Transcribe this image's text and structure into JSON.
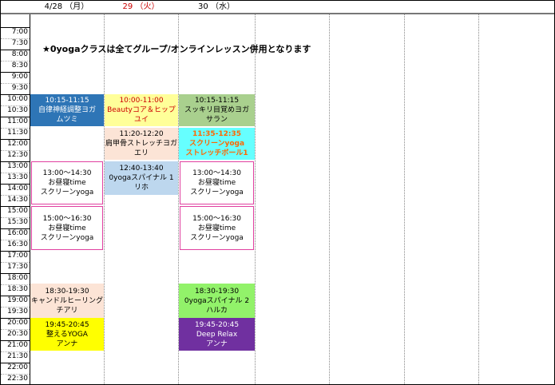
{
  "headers": [
    {
      "text": "4/28 （月）",
      "red": false
    },
    {
      "text": "29 （火）",
      "red": true
    },
    {
      "text": "30 （水）",
      "red": false
    },
    {
      "text": "",
      "red": false
    },
    {
      "text": "",
      "red": false
    },
    {
      "text": "",
      "red": false
    },
    {
      "text": "",
      "red": false
    }
  ],
  "times": [
    "7:00",
    "7:30",
    "8:00",
    "8:30",
    "9:00",
    "9:30",
    "10:00",
    "10:30",
    "11:00",
    "11:30",
    "12:00",
    "12:30",
    "13:00",
    "13:30",
    "14:00",
    "14:30",
    "15:00",
    "15:30",
    "16:00",
    "16:30",
    "17:00",
    "17:30",
    "18:00",
    "18:30",
    "19:00",
    "19:30",
    "20:00",
    "20:30",
    "21:00",
    "21:30",
    "22:00",
    "22:30"
  ],
  "notice": "★0yogaクラスは全てグループ/オンラインレッスン併用となります",
  "classes": {
    "mon_1015": {
      "time": "10:15-11:15",
      "name": "自律神経調整ヨガ",
      "teacher": "ムツミ",
      "color": "#2e75b6",
      "text_color": "#ffffff"
    },
    "mon_1300": {
      "time": "13:00〜14:30",
      "name": "お昼寝time",
      "teacher": "スクリーンyoga",
      "color": "#ffffff",
      "text_color": "#000000"
    },
    "mon_1500": {
      "time": "15:00〜16:30",
      "name": "お昼寝time",
      "teacher": "スクリーンyoga",
      "color": "#ffffff",
      "text_color": "#000000"
    },
    "mon_1830": {
      "time": "18:30-19:30",
      "name": "キャンドルヒーリング",
      "teacher": "チアリ",
      "color": "#fce4d6",
      "text_color": "#000000"
    },
    "mon_1945": {
      "time": "19:45-20:45",
      "name": "整えるYOGA",
      "teacher": "アンナ",
      "color": "#ffff00",
      "text_color": "#000000"
    },
    "tue_1000": {
      "time": "10:00-11:00",
      "name": "Beautyコア＆ヒップ",
      "teacher": "ユイ",
      "color": "#ffff99",
      "text_color": "#cc0000"
    },
    "tue_1120": {
      "time": "11:20-12:20",
      "name": "肩甲骨ストレッチヨガ",
      "teacher": "エリ",
      "color": "#fce4d6",
      "text_color": "#000000"
    },
    "tue_1240": {
      "time": "12:40-13:40",
      "name": "0yogaスパイナル 1",
      "teacher": "リホ",
      "color": "#bdd7ee",
      "text_color": "#000000"
    },
    "wed_1015": {
      "time": "10:15-11:15",
      "name": "スッキリ目覚めヨガ",
      "teacher": "サラン",
      "color": "#a9d08e",
      "text_color": "#000000"
    },
    "wed_1135": {
      "time": "11:35-12:35",
      "name": "スクリーンyoga",
      "teacher": "ストレッチボール1",
      "color": "#66ffff",
      "text_color": "#ff6600"
    },
    "wed_1300": {
      "time": "13:00〜14:30",
      "name": "お昼寝time",
      "teacher": "スクリーンyoga",
      "color": "#ffffff",
      "text_color": "#000000"
    },
    "wed_1500": {
      "time": "15:00〜16:30",
      "name": "お昼寝time",
      "teacher": "スクリーンyoga",
      "color": "#ffffff",
      "text_color": "#000000"
    },
    "wed_1830": {
      "time": "18:30-19:30",
      "name": "0yogaスパイナル 2",
      "teacher": "ハルカ",
      "color": "#92f26a",
      "text_color": "#000000"
    },
    "wed_1945": {
      "time": "19:45-20:45",
      "name": "Deep Relax",
      "teacher": "アンナ",
      "color": "#7030a0",
      "text_color": "#ffffff"
    }
  }
}
